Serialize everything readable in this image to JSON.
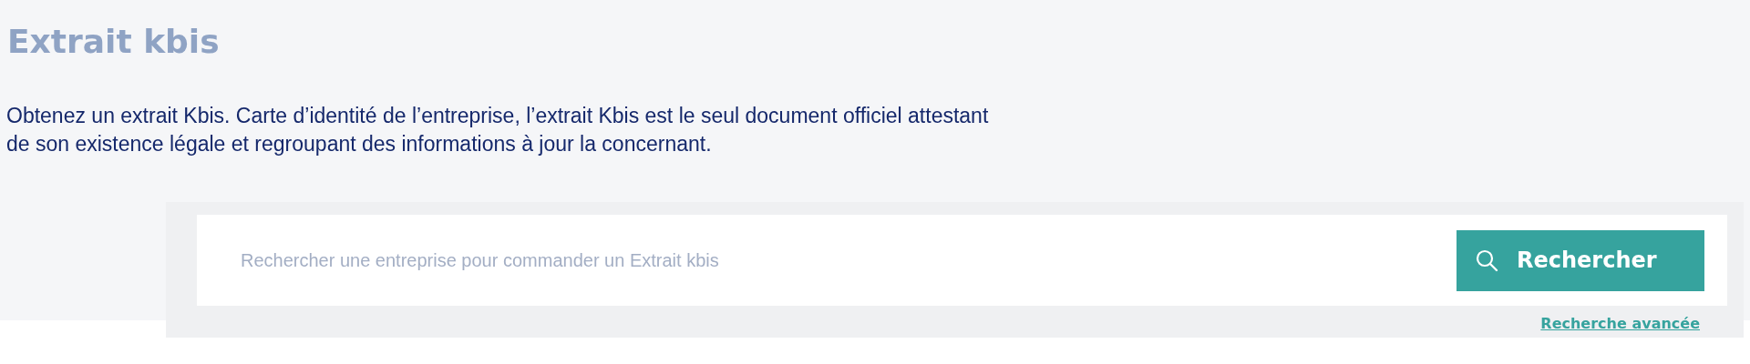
{
  "title": "Extrait kbis",
  "description": "Obtenez un extrait Kbis. Carte d’identité de l’entreprise, l’extrait Kbis est le seul document officiel attestant de son existence légale et regroupant des informations à jour la concernant.",
  "search": {
    "placeholder": "Rechercher une entreprise pour commander un Extrait kbis",
    "button": "Rechercher",
    "advanced_link": "Recherche avancée"
  }
}
